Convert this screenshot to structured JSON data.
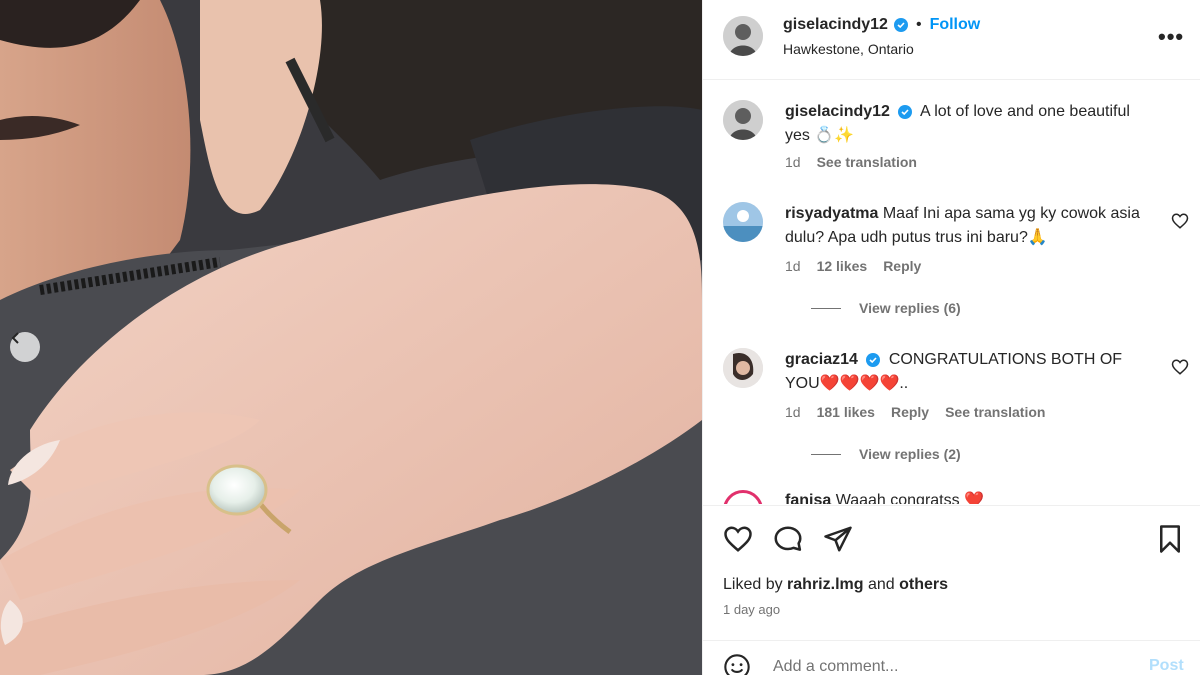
{
  "post": {
    "username": "giselacindy12",
    "follow_label": "Follow",
    "separator": "•",
    "location": "Hawkestone, Ontario",
    "more_label": "•••"
  },
  "caption": {
    "username": "giselacindy12",
    "text": "A lot of love and one beautiful yes 💍✨",
    "time": "1d",
    "translate": "See translation"
  },
  "comments": [
    {
      "username": "risyadyatma",
      "text": "Maaf Ini apa sama yg ky cowok asia dulu? Apa udh putus trus ini baru?🙏",
      "time": "1d",
      "likes": "12 likes",
      "reply": "Reply",
      "view_replies": "View replies (6)"
    },
    {
      "username": "graciaz14",
      "text": "CONGRATULATIONS BOTH OF YOU❤️❤️❤️❤️..",
      "time": "1d",
      "likes": "181 likes",
      "reply": "Reply",
      "translate": "See translation",
      "view_replies": "View replies (2)"
    }
  ],
  "partial_comment": {
    "username": "fanisa",
    "text": "Waaah congratss ❤️"
  },
  "liked_by": {
    "prefix": "Liked by",
    "user": "rahriz.lmg",
    "middle": "and",
    "others": "others",
    "time": "1 day ago"
  },
  "composer": {
    "placeholder": "Add a comment...",
    "post_label": "Post"
  },
  "colors": {
    "accent": "#0095f6",
    "verified": "#1d9bf0",
    "muted": "#737373",
    "post_disabled": "#b2dffc"
  }
}
